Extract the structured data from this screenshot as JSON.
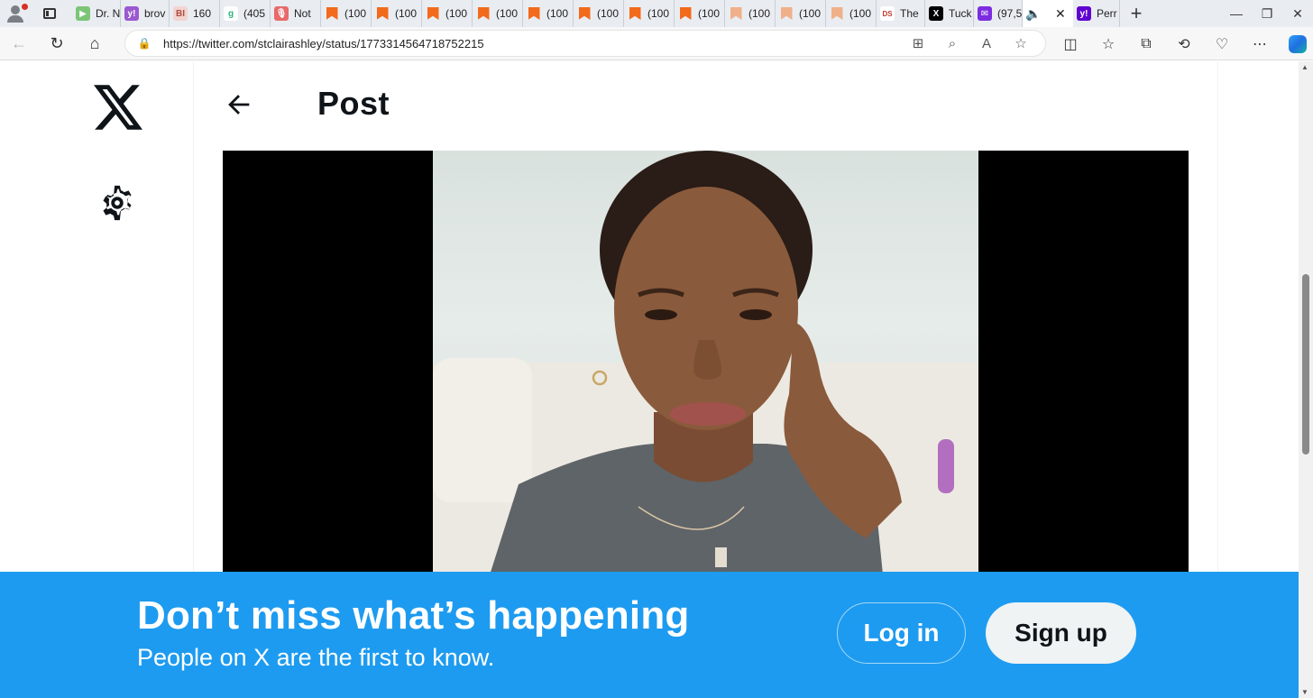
{
  "browser": {
    "tabs": [
      {
        "label": "",
        "icon": "extension-icon"
      },
      {
        "label": "Dr. N",
        "icon": "play-icon",
        "color": "#7cc576"
      },
      {
        "label": "brov",
        "icon": "yahoo-icon",
        "color": "#9b59d0"
      },
      {
        "label": "160",
        "icon": "bi-icon",
        "color": "#f2d4d0"
      },
      {
        "label": "(405",
        "icon": "g-icon",
        "color": "#8fd1a8"
      },
      {
        "label": "Not",
        "icon": "mic-icon",
        "color": "#e86a6a"
      },
      {
        "label": "(100",
        "icon": "bookmark-icon"
      },
      {
        "label": "(100",
        "icon": "bookmark-icon"
      },
      {
        "label": "(100",
        "icon": "bookmark-icon"
      },
      {
        "label": "(100",
        "icon": "bookmark-icon"
      },
      {
        "label": "(100",
        "icon": "bookmark-icon"
      },
      {
        "label": "(100",
        "icon": "bookmark-icon"
      },
      {
        "label": "(100",
        "icon": "bookmark-icon"
      },
      {
        "label": "(100",
        "icon": "bookmark-icon"
      },
      {
        "label": "(100",
        "icon": "bookmark-light-icon"
      },
      {
        "label": "(100",
        "icon": "bookmark-light-icon"
      },
      {
        "label": "(100",
        "icon": "bookmark-light-icon"
      },
      {
        "label": "The",
        "icon": "news-icon"
      },
      {
        "label": "Tuck",
        "icon": "x-icon"
      },
      {
        "label": "(97,5",
        "icon": "mail-icon"
      },
      {
        "label": "",
        "icon": "speaker-icon",
        "active": true
      },
      {
        "label": "Perr",
        "icon": "yahoo-icon"
      }
    ],
    "url": "https://twitter.com/stclairashley/status/1773314564718752215"
  },
  "header": {
    "title": "Post"
  },
  "banner": {
    "title": "Don’t miss what’s happening",
    "subtitle": "People on X are the first to know.",
    "login_label": "Log in",
    "signup_label": "Sign up"
  },
  "colors": {
    "brand_blue": "#1d9bf0",
    "text_primary": "#0f1419"
  }
}
